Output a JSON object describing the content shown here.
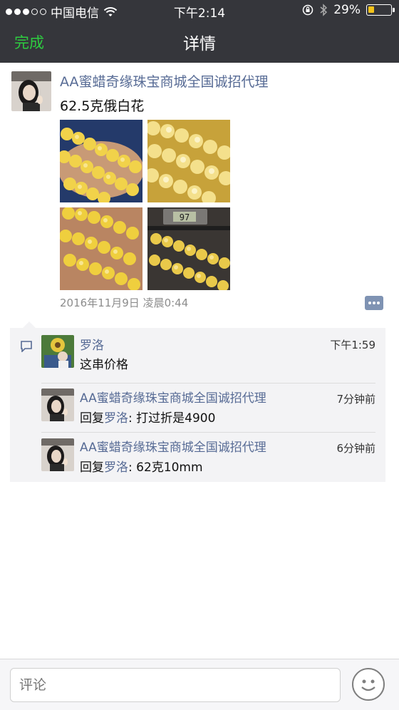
{
  "status_bar": {
    "carrier": "中国电信",
    "time": "下午2:14",
    "battery_percent": "29%",
    "battery_level": 0.29,
    "icons": [
      "signal-dots-icon",
      "wifi-icon",
      "rotation-lock-icon",
      "bluetooth-icon",
      "battery-icon"
    ]
  },
  "nav": {
    "done_label": "完成",
    "title": "详情"
  },
  "post": {
    "author": "AA蜜蜡奇缘珠宝商城全国诚招代理",
    "text": "62.5克俄白花",
    "photos": [
      "amber-bracelet-photo-1",
      "amber-bracelet-photo-2",
      "amber-bracelet-photo-3",
      "amber-bracelet-photo-4"
    ],
    "scale_reading": "97",
    "timestamp": "2016年11月9日 凌晨0:44"
  },
  "comments": [
    {
      "name": "罗洛",
      "text": "这串价格",
      "time": "下午1:59"
    },
    {
      "name": "AA蜜蜡奇缘珠宝商城全国诚招代理",
      "reply_prefix": "回复",
      "reply_to": "罗洛",
      "text": ": 打过折是4900",
      "time": "7分钟前"
    },
    {
      "name": "AA蜜蜡奇缘珠宝商城全国诚招代理",
      "reply_prefix": "回复",
      "reply_to": "罗洛",
      "text": ": 62克10mm",
      "time": "6分钟前"
    }
  ],
  "input": {
    "placeholder": "评论"
  },
  "colors": {
    "nav_bg": "#35363b",
    "done_green": "#2ecc40",
    "link_blue": "#576b95",
    "battery_yellow": "#f3c31a",
    "comment_bg": "#f3f3f5"
  }
}
